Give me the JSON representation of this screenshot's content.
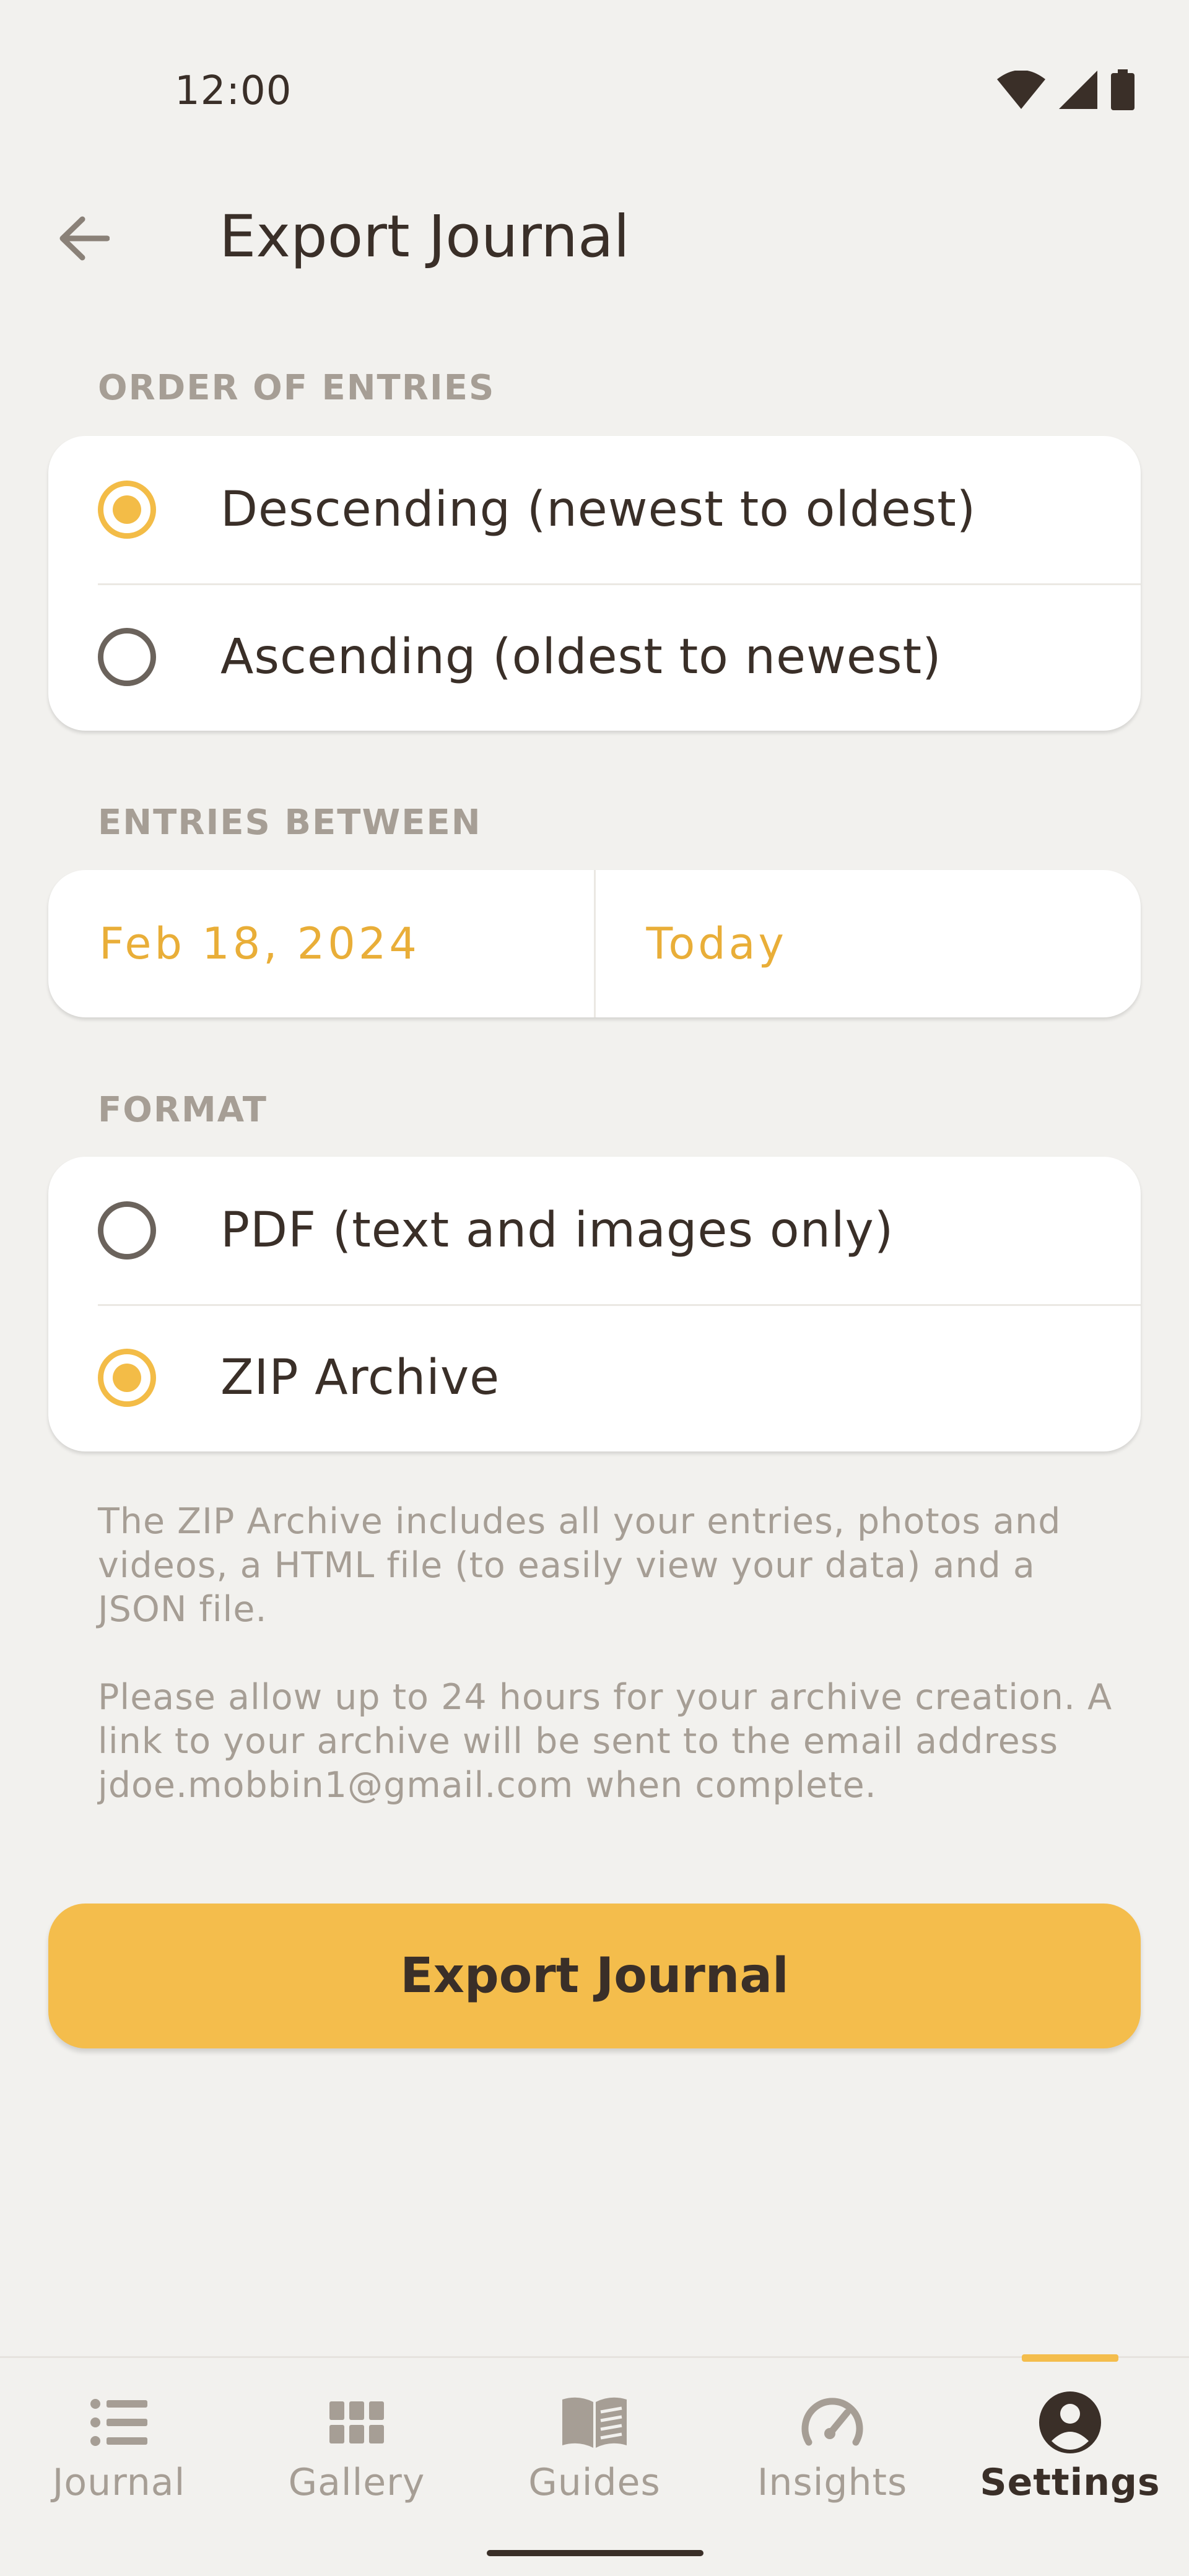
{
  "status_bar": {
    "time": "12:00",
    "icons": [
      "wifi-icon",
      "cellular-icon",
      "battery-icon"
    ]
  },
  "app_bar": {
    "back_icon": "arrow-left-icon",
    "title": "Export Journal"
  },
  "order_section": {
    "label": "ORDER OF ENTRIES",
    "options": [
      {
        "label": "Descending (newest to oldest)",
        "selected": true
      },
      {
        "label": "Ascending (oldest to newest)",
        "selected": false
      }
    ]
  },
  "range_section": {
    "label": "ENTRIES BETWEEN",
    "start": "Feb 18, 2024",
    "end": "Today"
  },
  "format_section": {
    "label": "FORMAT",
    "options": [
      {
        "label": "PDF (text and images only)",
        "selected": false
      },
      {
        "label": "ZIP Archive",
        "selected": true
      }
    ]
  },
  "info": {
    "paragraph1": "The ZIP Archive includes all your entries, photos and videos, a HTML file (to easily view your data) and a JSON file.",
    "paragraph2": "Please allow up to 24 hours for your archive creation. A link to your archive will be sent to the email address jdoe.mobbin1@gmail.com when complete."
  },
  "export_button": {
    "label": "Export Journal"
  },
  "bottom_nav": {
    "items": [
      {
        "label": "Journal",
        "icon": "list-icon",
        "active": false
      },
      {
        "label": "Gallery",
        "icon": "grid-icon",
        "active": false
      },
      {
        "label": "Guides",
        "icon": "book-icon",
        "active": false
      },
      {
        "label": "Insights",
        "icon": "gauge-icon",
        "active": false
      },
      {
        "label": "Settings",
        "icon": "account-circle-icon",
        "active": true
      }
    ]
  },
  "colors": {
    "accent": "#f4bd4c",
    "background": "#f2f1ee",
    "text": "#3a2f28",
    "muted": "#a69e95"
  }
}
